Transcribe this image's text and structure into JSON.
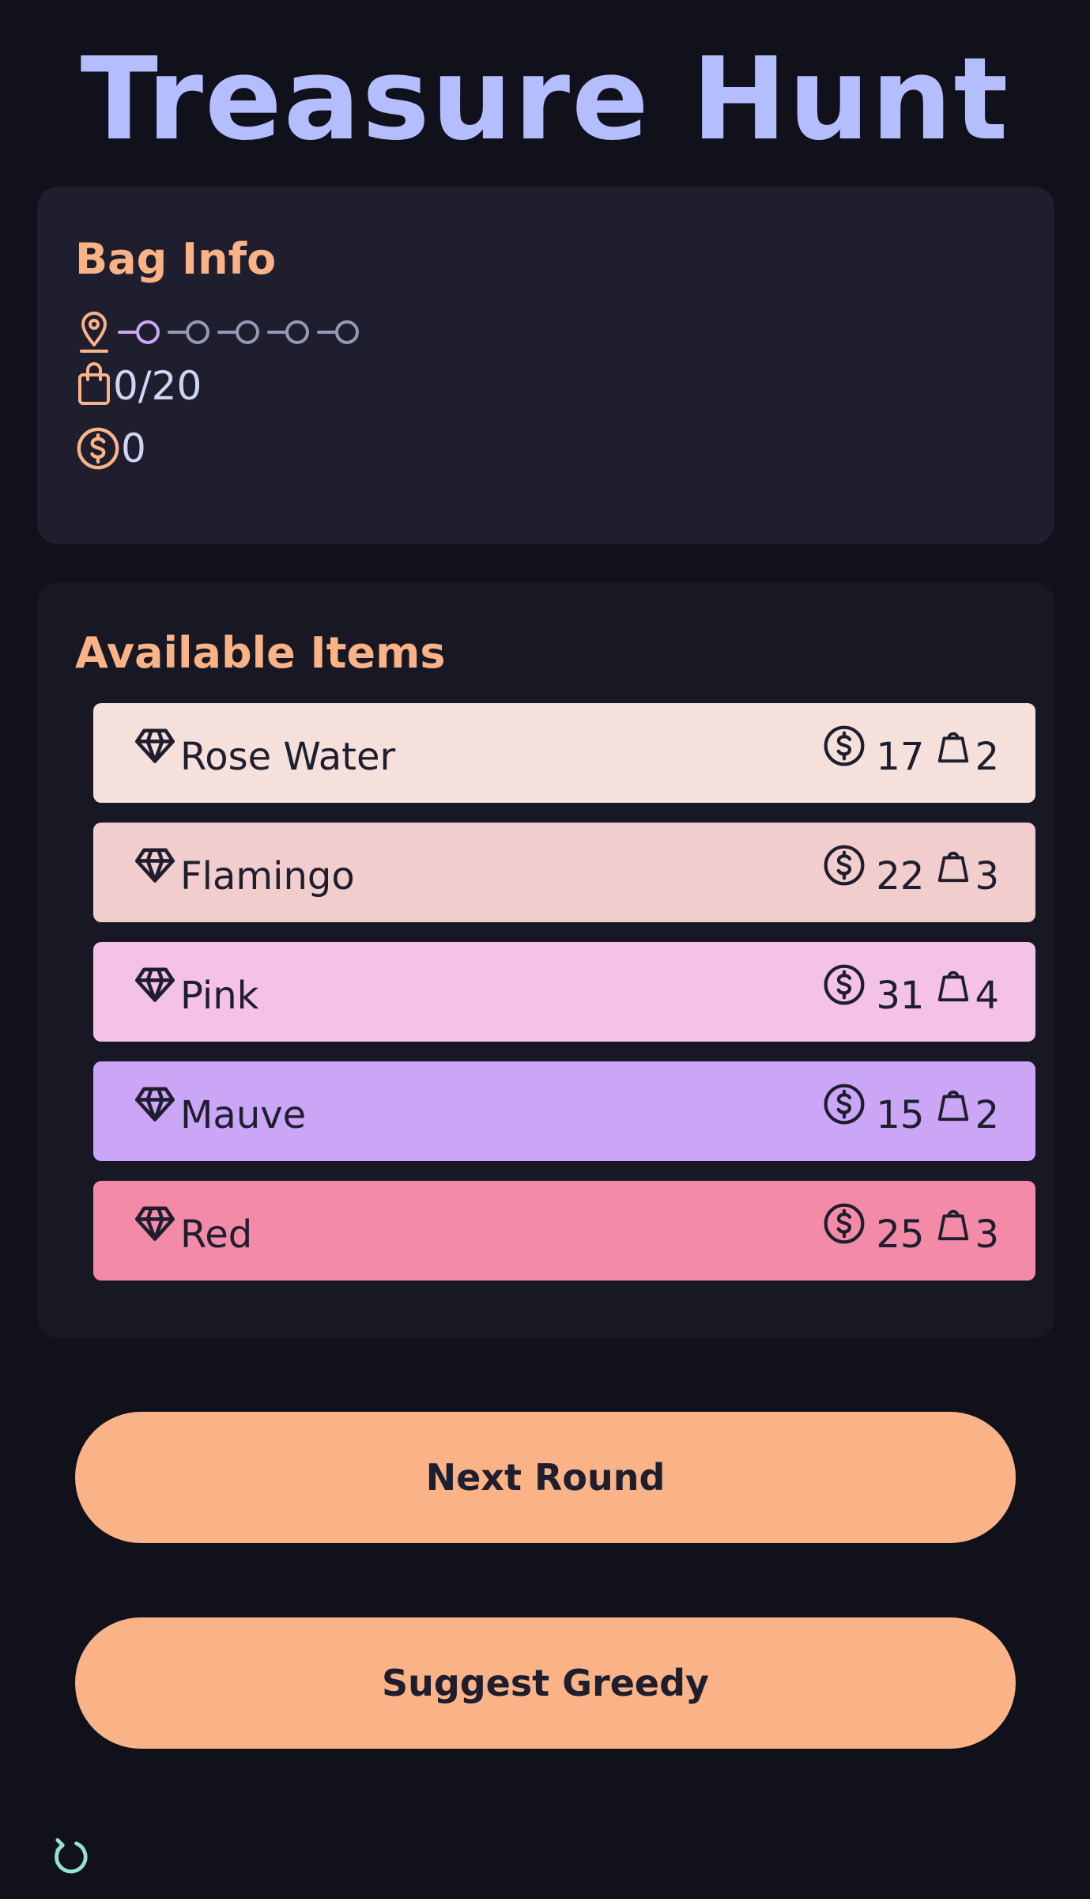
{
  "title": "Treasure Hunt",
  "bag_info": {
    "heading": "Bag Info",
    "progress": {
      "total_rounds": 5,
      "current_round": 1
    },
    "weight": "0/20",
    "money": "0"
  },
  "available_items": {
    "heading": "Available Items",
    "items": [
      {
        "name": "Rose Water",
        "value": "17",
        "weight": "2",
        "color": "#f5e0dc"
      },
      {
        "name": "Flamingo",
        "value": "22",
        "weight": "3",
        "color": "#f2cdcd"
      },
      {
        "name": "Pink",
        "value": "31",
        "weight": "4",
        "color": "#f5c2e7"
      },
      {
        "name": "Mauve",
        "value": "15",
        "weight": "2",
        "color": "#cba6f7"
      },
      {
        "name": "Red",
        "value": "25",
        "weight": "3",
        "color": "#f38ba8"
      }
    ]
  },
  "buttons": {
    "next_round": "Next Round",
    "suggest_greedy": "Suggest Greedy"
  },
  "icons": {
    "location": "map-pin-icon",
    "bag": "shopping-bag-icon",
    "coin": "dollar-coin-icon",
    "gem": "diamond-icon",
    "weight": "weight-icon",
    "refresh": "refresh-icon"
  },
  "colors": {
    "accent": "#fab387",
    "title": "#b4befe",
    "progress_active": "#cba6f7",
    "progress_inactive": "#9399b2",
    "refresh": "#94e2d5"
  }
}
